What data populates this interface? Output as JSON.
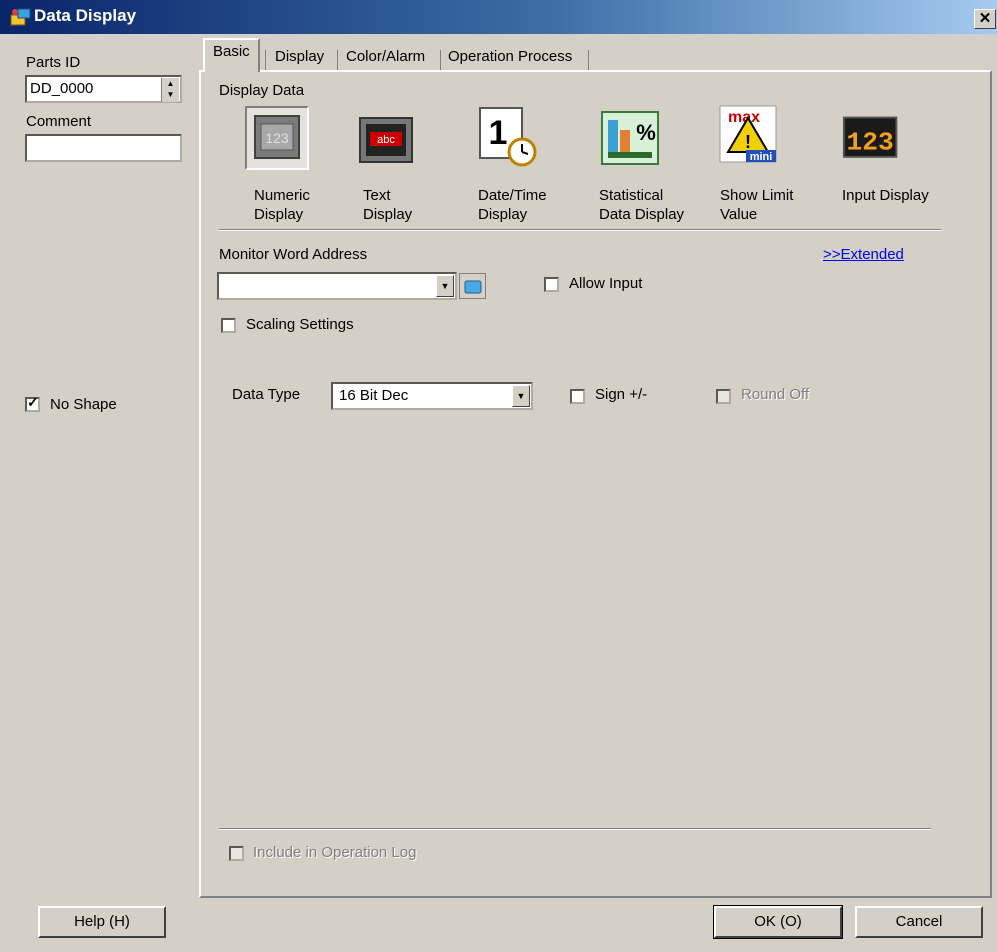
{
  "window": {
    "title": "Data Display",
    "close_glyph": "✕"
  },
  "left": {
    "parts_id_label": "Parts ID",
    "parts_id_value": "DD_0000",
    "comment_label": "Comment",
    "comment_value": "",
    "no_shape_label": "No Shape",
    "no_shape_checked": true,
    "help_button": "Help (H)"
  },
  "tabs": [
    {
      "label": "Basic",
      "active": true
    },
    {
      "label": "Display",
      "active": false
    },
    {
      "label": "Color/Alarm",
      "active": false
    },
    {
      "label": "Operation Process",
      "active": false
    }
  ],
  "display_data": {
    "label": "Display Data",
    "items": [
      {
        "line1": "Numeric",
        "line2": "Display",
        "icon": "numeric-display-icon",
        "selected": true
      },
      {
        "line1": "Text",
        "line2": "Display",
        "icon": "text-display-icon",
        "selected": false
      },
      {
        "line1": "Date/Time",
        "line2": "Display",
        "icon": "date-time-display-icon",
        "selected": false
      },
      {
        "line1": "Statistical",
        "line2": "Data Display",
        "icon": "statistical-display-icon",
        "selected": false
      },
      {
        "line1": "Show Limit",
        "line2": "Value",
        "icon": "show-limit-icon",
        "selected": false
      },
      {
        "line1": "Input Display",
        "line2": "",
        "icon": "input-display-icon",
        "selected": false
      }
    ],
    "icon_texts": {
      "text_sample": "abc",
      "date_digit": "1",
      "stat_symbol": "%",
      "limit_max": "max",
      "limit_mini": "mini",
      "limit_warn": "!",
      "input_digits": "123"
    }
  },
  "monitor": {
    "label": "Monitor Word Address",
    "value": "",
    "extended_link": ">>Extended",
    "allow_input_label": "Allow Input",
    "allow_input_checked": false,
    "scaling_label": "Scaling Settings",
    "scaling_checked": false
  },
  "data_type": {
    "label": "Data Type",
    "value": "16 Bit Dec",
    "sign_label": "Sign +/-",
    "sign_checked": false,
    "round_off_label": "Round Off",
    "round_off_checked": false
  },
  "operation_log_label": "Include in Operation Log",
  "buttons": {
    "ok": "OK (O)",
    "cancel": "Cancel"
  },
  "colors": {
    "title_start": "#0a246a",
    "title_end": "#a6caf0",
    "face": "#d4d0c8",
    "link": "#0000ee"
  }
}
